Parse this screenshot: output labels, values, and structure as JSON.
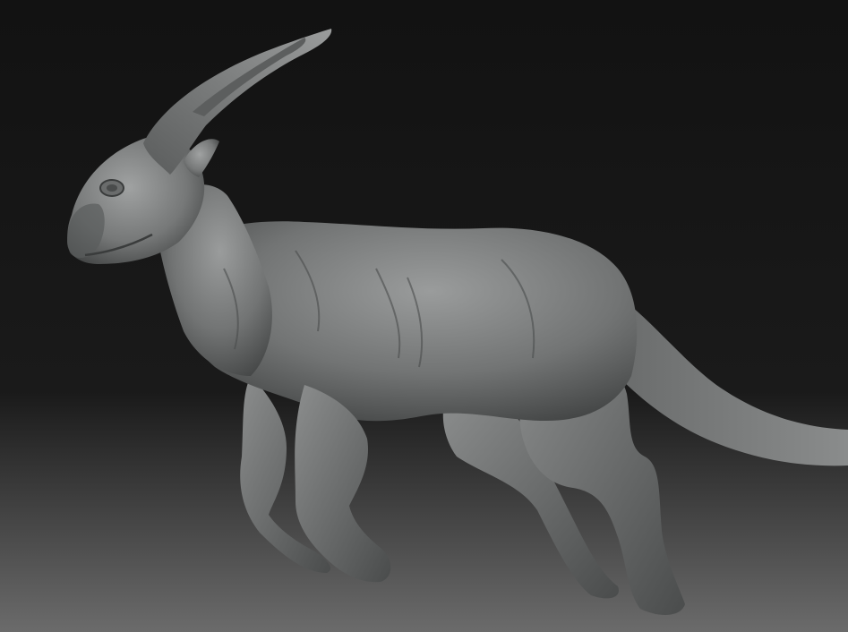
{
  "scene": {
    "subject": "creature-sculpt",
    "material": "clay-gray",
    "colors": {
      "background_top": "#121212",
      "background_mid": "#1a1a1a",
      "background_bottom": "#6b6b6b",
      "skin_light": "#9a9c9c",
      "skin_mid": "#6e7070",
      "skin_dark": "#3a3c3c",
      "shadow": "#2a2b2b"
    }
  }
}
